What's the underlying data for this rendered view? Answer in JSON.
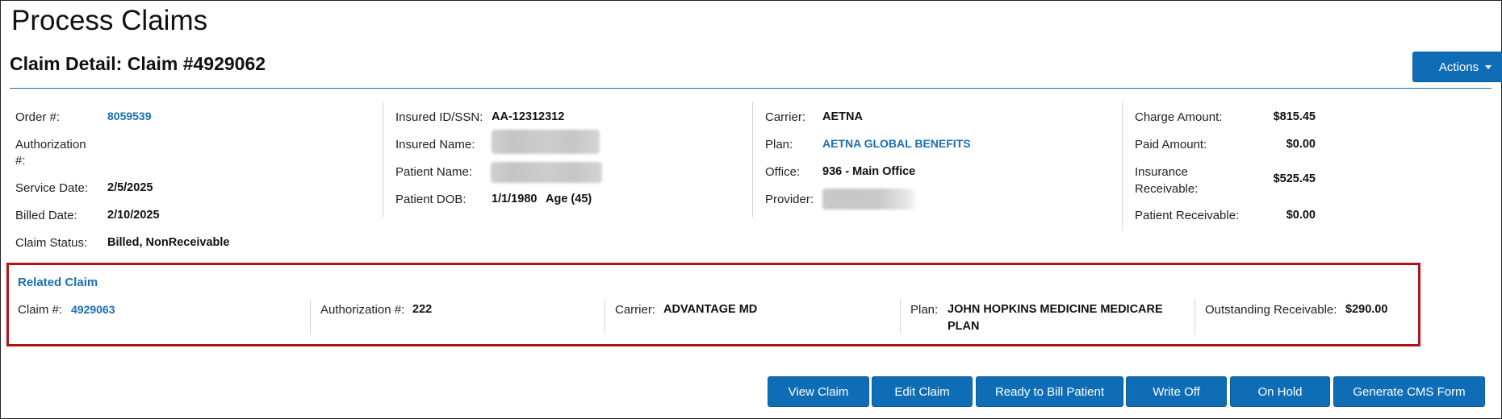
{
  "page": {
    "title": "Process Claims"
  },
  "claim_detail": {
    "title": "Claim Detail: Claim #4929062",
    "actions_label": "Actions"
  },
  "order_section": {
    "order_label": "Order #:",
    "order_value": "8059539",
    "authorization_label": "Authorization #:",
    "authorization_value": "",
    "service_date_label": "Service Date:",
    "service_date_value": "2/5/2025",
    "billed_date_label": "Billed Date:",
    "billed_date_value": "2/10/2025",
    "claim_status_label": "Claim Status:",
    "claim_status_value": "Billed, NonReceivable"
  },
  "insured_section": {
    "insured_id_label": "Insured ID/SSN:",
    "insured_id_value": "AA-12312312",
    "insured_name_label": "Insured Name:",
    "patient_name_label": "Patient Name:",
    "patient_dob_label": "Patient DOB:",
    "patient_dob_value": "1/1/1980",
    "patient_age_value": "Age (45)"
  },
  "carrier_section": {
    "carrier_label": "Carrier:",
    "carrier_value": "AETNA",
    "plan_label": "Plan:",
    "plan_value": "AETNA GLOBAL BENEFITS",
    "office_label": "Office:",
    "office_value": "936 - Main Office",
    "provider_label": "Provider:"
  },
  "amounts_section": {
    "charge_label": "Charge Amount:",
    "charge_value": "$815.45",
    "paid_label": "Paid Amount:",
    "paid_value": "$0.00",
    "insurance_receivable_label": "Insurance Receivable:",
    "insurance_receivable_value": "$525.45",
    "patient_receivable_label": "Patient Receivable:",
    "patient_receivable_value": "$0.00"
  },
  "related_claim": {
    "title": "Related Claim",
    "claim_label": "Claim #:",
    "claim_value": "4929063",
    "authorization_label": "Authorization #:",
    "authorization_value": "222",
    "carrier_label": "Carrier:",
    "carrier_value": "ADVANTAGE MD",
    "plan_label": "Plan:",
    "plan_value_line1": "JOHN HOPKINS MEDICINE MEDICARE",
    "plan_value_line2": "PLAN",
    "outstanding_label": "Outstanding Receivable:",
    "outstanding_value": "$290.00"
  },
  "footer_buttons": {
    "view_claim": "View Claim",
    "edit_claim": "Edit Claim",
    "ready_to_bill": "Ready to Bill Patient",
    "write_off": "Write Off",
    "on_hold": "On Hold",
    "generate_cms": "Generate CMS Form"
  },
  "colors": {
    "primary": "#0f6db6",
    "link": "#1a6fb3",
    "highlight_border": "#b5121b"
  }
}
